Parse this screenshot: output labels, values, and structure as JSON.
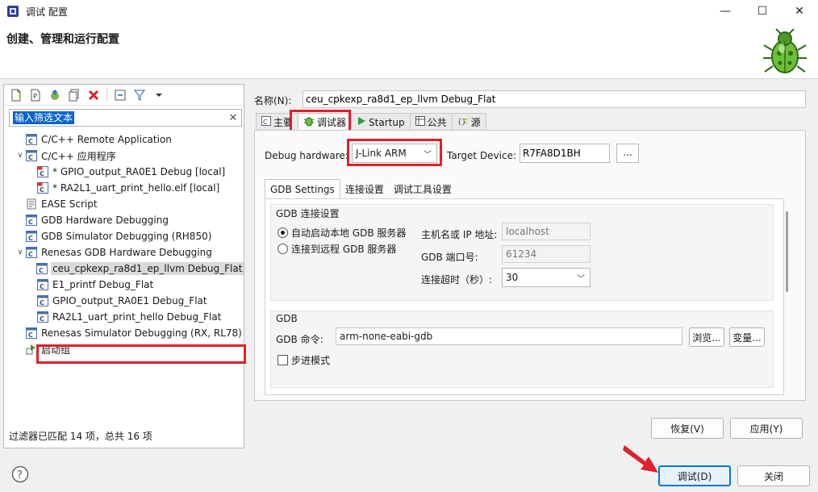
{
  "window": {
    "title": "调试 配置",
    "controls": {
      "minimize": "—",
      "maximize": "☐",
      "close": "✕"
    }
  },
  "banner": {
    "title": "创建、管理和运行配置"
  },
  "left": {
    "filter_text": "输入筛选文本",
    "clear_symbol": "✕",
    "tree": [
      {
        "label": "C/C++ Remote Application",
        "level": 1,
        "expanded": null,
        "icon": "c-config-icon"
      },
      {
        "label": "C/C++ 应用程序",
        "level": 1,
        "expanded": true,
        "icon": "c-config-icon"
      },
      {
        "label": "* GPIO_output_RA0E1 Debug [local]",
        "level": 2,
        "expanded": null,
        "icon": "c-launch-icon"
      },
      {
        "label": "* RA2L1_uart_print_hello.elf [local]",
        "level": 2,
        "expanded": null,
        "icon": "c-launch-icon"
      },
      {
        "label": "EASE Script",
        "level": 1,
        "expanded": null,
        "icon": "script-icon"
      },
      {
        "label": "GDB Hardware Debugging",
        "level": 1,
        "expanded": null,
        "icon": "c-config-icon"
      },
      {
        "label": "GDB Simulator Debugging (RH850)",
        "level": 1,
        "expanded": null,
        "icon": "c-config-icon"
      },
      {
        "label": "Renesas GDB Hardware Debugging",
        "level": 1,
        "expanded": true,
        "icon": "c-config-icon"
      },
      {
        "label": "ceu_cpkexp_ra8d1_ep_llvm Debug_Flat",
        "level": 2,
        "expanded": null,
        "icon": "c-config-icon",
        "selected": true
      },
      {
        "label": "E1_printf Debug_Flat",
        "level": 2,
        "expanded": null,
        "icon": "c-config-icon"
      },
      {
        "label": "GPIO_output_RA0E1 Debug_Flat",
        "level": 2,
        "expanded": null,
        "icon": "c-config-icon"
      },
      {
        "label": "RA2L1_uart_print_hello Debug_Flat",
        "level": 2,
        "expanded": null,
        "icon": "c-config-icon"
      },
      {
        "label": "Renesas Simulator Debugging (RX, RL78)",
        "level": 1,
        "expanded": null,
        "icon": "c-config-icon"
      },
      {
        "label": "启动组",
        "level": 1,
        "expanded": null,
        "icon": "launch-group-icon"
      }
    ],
    "status": "过滤器已匹配 14 项，总共 16 项"
  },
  "right": {
    "name_label": "名称(N):",
    "name_value": "ceu_cpkexp_ra8d1_ep_llvm Debug_Flat",
    "tabs": [
      {
        "label": "主要",
        "icon": "main-tab-icon"
      },
      {
        "label": "调试器",
        "icon": "debugger-tab-icon",
        "active": true
      },
      {
        "label": "Startup",
        "icon": "startup-tab-icon"
      },
      {
        "label": "公共",
        "icon": "common-tab-icon"
      },
      {
        "label": "源",
        "icon": "source-tab-icon"
      }
    ],
    "debug_hw_label": "Debug hardware:",
    "debug_hw_value": "J-Link ARM",
    "target_label": "Target Device:",
    "target_value": "R7FA8D1BH",
    "browse_dots": "...",
    "sub_tabs": [
      "GDB Settings",
      "连接设置",
      "调试工具设置"
    ],
    "gdb_conn": {
      "title": "GDB 连接设置",
      "radio_local": "自动启动本地 GDB 服务器",
      "radio_remote": "连接到远程 GDB 服务器",
      "host_label": "主机名或 IP 地址:",
      "host_value": "localhost",
      "port_label": "GDB 端口号:",
      "port_value": "61234",
      "timeout_label": "连接超时（秒）:",
      "timeout_value": "30"
    },
    "gdb": {
      "title": "GDB",
      "cmd_label": "GDB 命令:",
      "cmd_value": "arm-none-eabi-gdb",
      "browse_label": "浏览...",
      "vars_label": "变量...",
      "step_label": "步进模式"
    },
    "revert_label": "恢复(V)",
    "apply_label": "应用(Y)"
  },
  "footer": {
    "debug_label": "调试(D)",
    "close_label": "关闭"
  },
  "colors": {
    "highlight": "#e0202a",
    "primary_border": "#0078d4",
    "selection": "#0a64d2"
  }
}
